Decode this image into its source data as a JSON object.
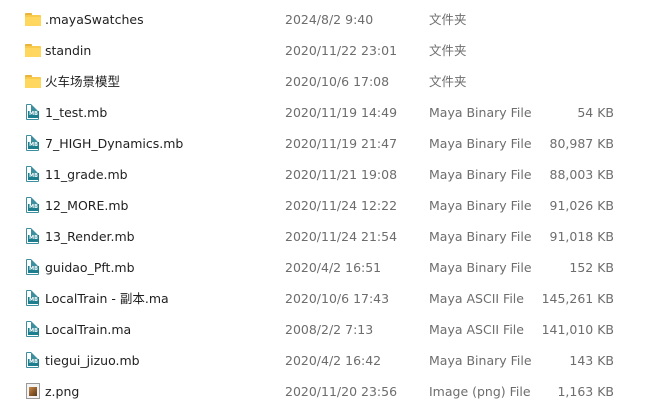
{
  "files": [
    {
      "name": ".mayaSwatches",
      "date": "2024/8/2 9:40",
      "type": "文件夹",
      "size": "",
      "icon": "folder-icon"
    },
    {
      "name": "standin",
      "date": "2020/11/22 23:01",
      "type": "文件夹",
      "size": "",
      "icon": "folder-icon"
    },
    {
      "name": "火车场景模型",
      "date": "2020/10/6 17:08",
      "type": "文件夹",
      "size": "",
      "icon": "folder-icon"
    },
    {
      "name": "1_test.mb",
      "date": "2020/11/19 14:49",
      "type": "Maya Binary File",
      "size": "54 KB",
      "icon": "maya-file-icon"
    },
    {
      "name": "7_HIGH_Dynamics.mb",
      "date": "2020/11/19 21:47",
      "type": "Maya Binary File",
      "size": "80,987 KB",
      "icon": "maya-file-icon"
    },
    {
      "name": "11_grade.mb",
      "date": "2020/11/21 19:08",
      "type": "Maya Binary File",
      "size": "88,003 KB",
      "icon": "maya-file-icon"
    },
    {
      "name": "12_MORE.mb",
      "date": "2020/11/24 12:22",
      "type": "Maya Binary File",
      "size": "91,026 KB",
      "icon": "maya-file-icon"
    },
    {
      "name": "13_Render.mb",
      "date": "2020/11/24 21:54",
      "type": "Maya Binary File",
      "size": "91,018 KB",
      "icon": "maya-file-icon"
    },
    {
      "name": "guidao_Pft.mb",
      "date": "2020/4/2 16:51",
      "type": "Maya Binary File",
      "size": "152 KB",
      "icon": "maya-file-icon"
    },
    {
      "name": "LocalTrain - 副本.ma",
      "date": "2020/10/6 17:43",
      "type": "Maya ASCII File",
      "size": "145,261 KB",
      "icon": "maya-file-icon"
    },
    {
      "name": "LocalTrain.ma",
      "date": "2008/2/2 7:13",
      "type": "Maya ASCII File",
      "size": "141,010 KB",
      "icon": "maya-file-icon"
    },
    {
      "name": "tiegui_jizuo.mb",
      "date": "2020/4/2 16:42",
      "type": "Maya Binary File",
      "size": "143 KB",
      "icon": "maya-file-icon"
    },
    {
      "name": "z.png",
      "date": "2020/11/20 23:56",
      "type": "Image (png) File",
      "size": "1,163 KB",
      "icon": "image-file-icon"
    }
  ],
  "colors": {
    "text_primary": "#1f1f1f",
    "text_secondary": "#6d6d6d",
    "folder": "#f8cb4e",
    "maya_icon": "#1e7e8e"
  },
  "icon_badges": {
    "maya": "MB"
  }
}
